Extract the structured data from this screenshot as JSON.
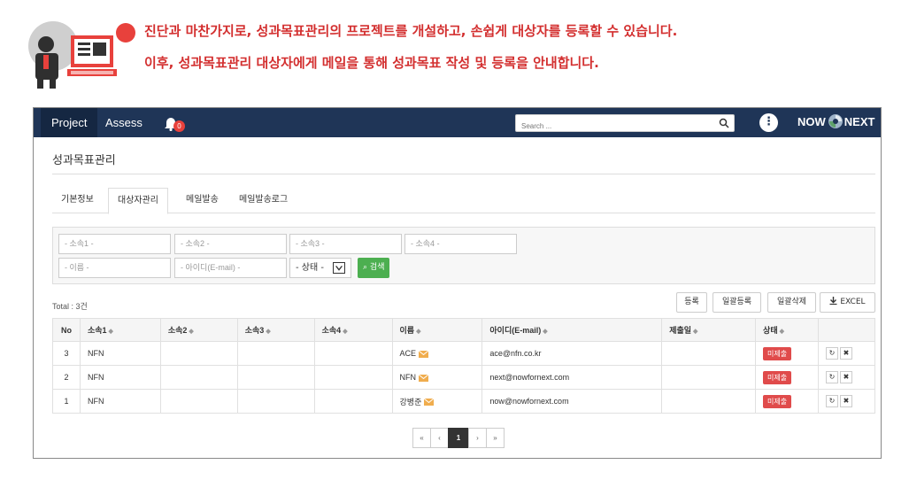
{
  "intro": {
    "line1": "진단과 마찬가지로, 성과목표관리의 프로젝트를 개설하고, 손쉽게 대상자를 등록할 수 있습니다.",
    "line2": "이후, 성과목표관리 대상자에게 메일을 통해 성과목표 작성 및 등록을 안내합니다.",
    "accent_color": "#e8413c"
  },
  "topbar": {
    "project": "Project",
    "assess": "Assess",
    "notification_count": "0",
    "search_placeholder": "Search ...",
    "menu_glyph": "⋮",
    "logo_left": "NOW",
    "logo_right": "NEXT",
    "bg_color": "#1f3557"
  },
  "page": {
    "title": "성과목표관리"
  },
  "tabs": [
    {
      "label": "기본정보",
      "active": false
    },
    {
      "label": "대상자관리",
      "active": true
    },
    {
      "label": "메일발송",
      "active": false
    },
    {
      "label": "메일발송로그",
      "active": false
    }
  ],
  "filters": {
    "org1": "- 소속1 -",
    "org2": "- 소속2 -",
    "org3": "- 소속3 -",
    "org4": "- 소속4 -",
    "name": "- 이름 -",
    "userid": "- 아이디(E-mail) -",
    "status": "- 상태 -",
    "search_button": "검색"
  },
  "summary": {
    "total": "Total : 3건"
  },
  "actions": {
    "register": "등록",
    "bulk_register": "일괄등록",
    "bulk_delete": "일괄삭제",
    "excel": "EXCEL"
  },
  "table": {
    "headers": [
      "No",
      "소속1",
      "소속2",
      "소속3",
      "소속4",
      "이름",
      "아이디(E-mail)",
      "제출일",
      "상태"
    ],
    "rows": [
      {
        "no": "3",
        "org1": "NFN",
        "org2": "",
        "org3": "",
        "org4": "",
        "name": "ACE",
        "email": "ace@nfn.co.kr",
        "submitted": "",
        "status": "미제출"
      },
      {
        "no": "2",
        "org1": "NFN",
        "org2": "",
        "org3": "",
        "org4": "",
        "name": "NFN",
        "email": "next@nowfornext.com",
        "submitted": "",
        "status": "미제출"
      },
      {
        "no": "1",
        "org1": "NFN",
        "org2": "",
        "org3": "",
        "org4": "",
        "name": "강병준",
        "email": "now@nowfornext.com",
        "submitted": "",
        "status": "미제출"
      }
    ],
    "status_color": "#e04b4b"
  },
  "pagination": {
    "first": "«",
    "prev": "‹",
    "current": "1",
    "next": "›",
    "last": "»"
  }
}
